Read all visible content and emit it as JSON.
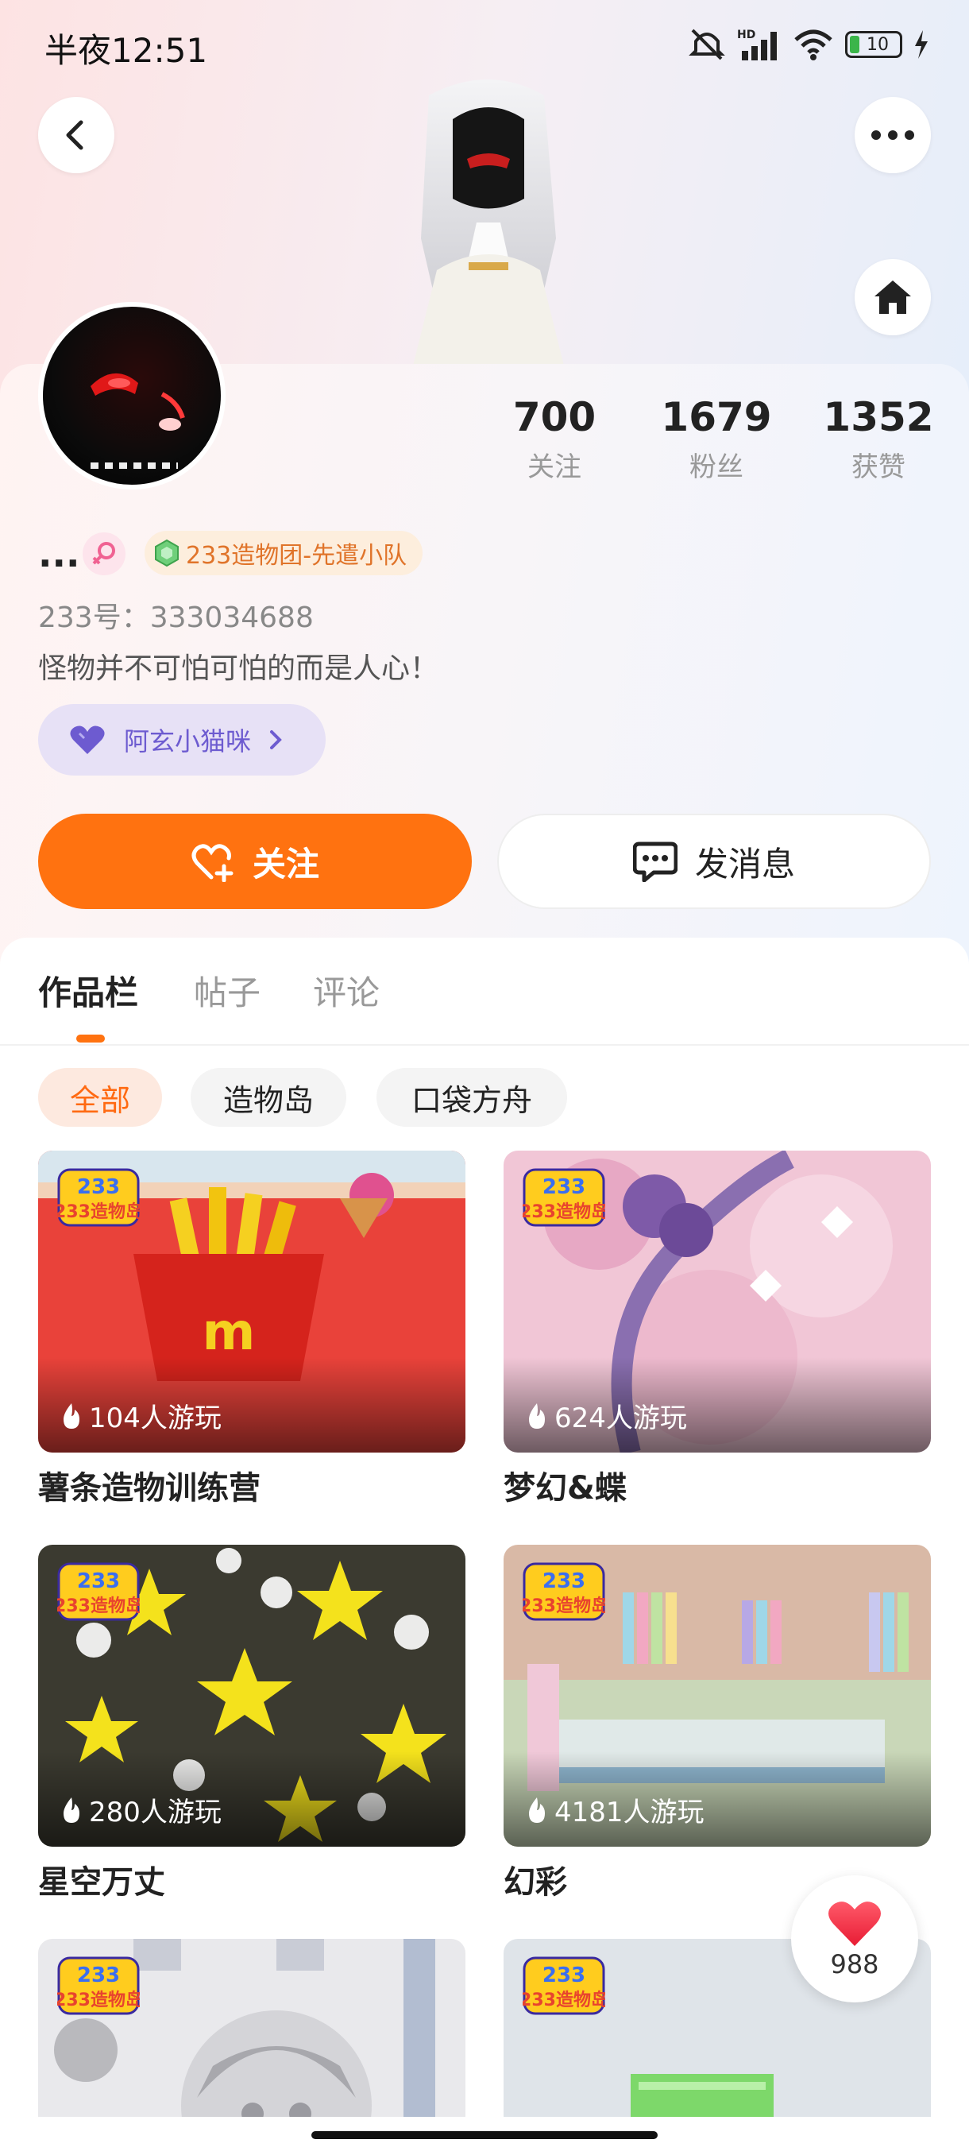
{
  "status": {
    "time": "半夜12:51",
    "battery": "10"
  },
  "profile": {
    "nickname": "...",
    "team_badge": "233造物团-先遣小队",
    "uid": "233号：333034688",
    "bio": "怪物并不可怕可怕的而是人心！",
    "fan_tag": "阿玄小猫咪"
  },
  "stats": [
    {
      "value": "700",
      "label": "关注"
    },
    {
      "value": "1679",
      "label": "粉丝"
    },
    {
      "value": "1352",
      "label": "获赞"
    }
  ],
  "actions": {
    "follow": "关注",
    "message": "发消息"
  },
  "tabs": [
    "作品栏",
    "帖子",
    "评论"
  ],
  "filters": [
    "全部",
    "造物岛",
    "口袋方舟"
  ],
  "logo_text": "233造物岛",
  "works": [
    {
      "title": "薯条造物训练营",
      "plays": "104人游玩"
    },
    {
      "title": "梦幻&蝶",
      "plays": "624人游玩"
    },
    {
      "title": "星空万丈",
      "plays": "280人游玩"
    },
    {
      "title": "幻彩",
      "plays": "4181人游玩"
    }
  ],
  "like_count": "988",
  "colors": {
    "accent": "#ff7210",
    "fan_tag": "#6d5bd0",
    "team_badge": "#e0742a"
  }
}
